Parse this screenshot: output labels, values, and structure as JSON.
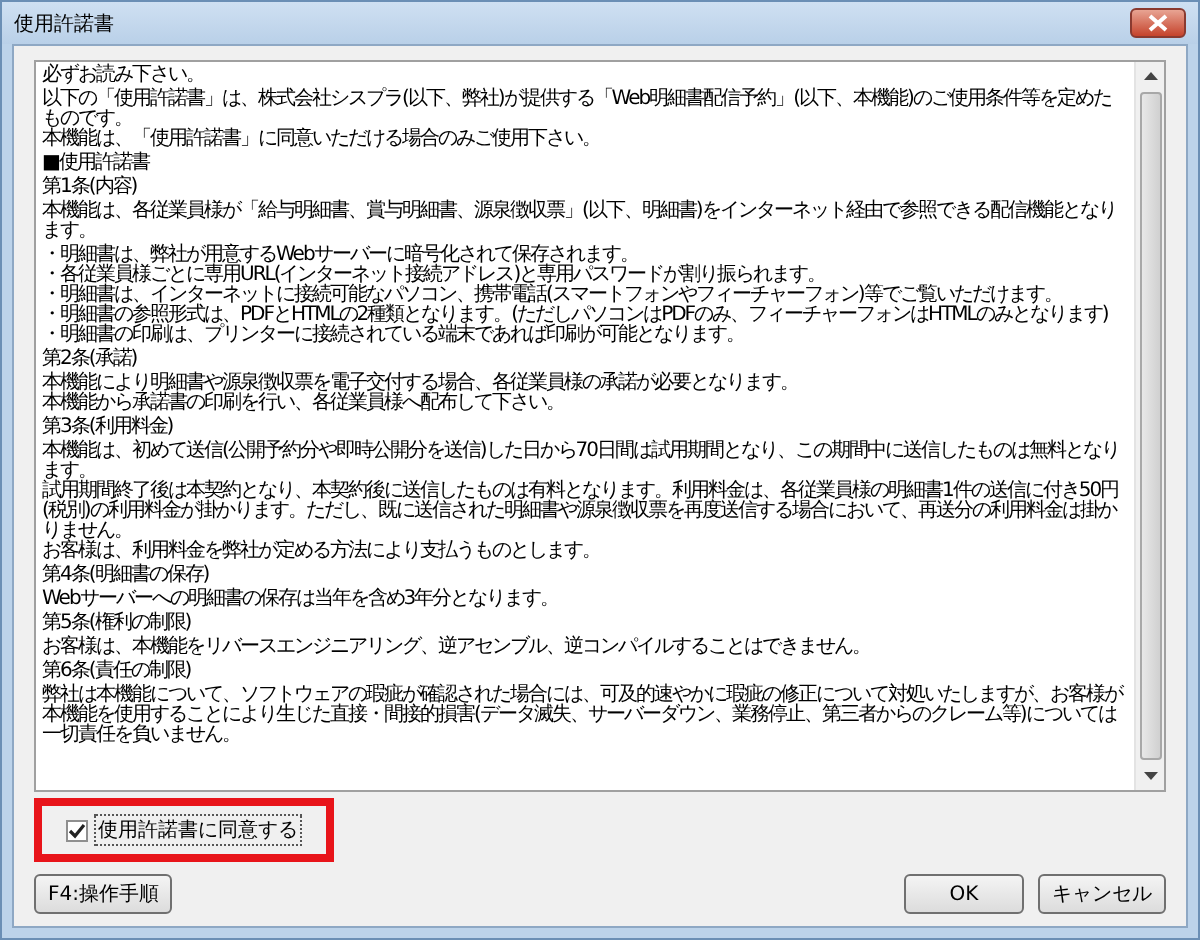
{
  "window": {
    "title": "使用許諾書"
  },
  "license_text": [
    {
      "lines": [
        "必ずお読み下さい。"
      ]
    },
    {
      "lines": [
        "以下の「使用許諾書」は、株式会社シスプラ(以下、弊社)が提供する「Web明細書配信予約」(以下、本機能)のご使用条件等を定めたものです。",
        "本機能は、「使用許諾書」に同意いただける場合のみご使用下さい。"
      ]
    },
    {
      "lines": [
        "■使用許諾書"
      ]
    },
    {
      "lines": [
        "第1条(内容)"
      ]
    },
    {
      "lines": [
        "本機能は、各従業員様が「給与明細書、賞与明細書、源泉徴収票」(以下、明細書)をインターネット経由で参照できる配信機能となります。"
      ]
    },
    {
      "lines": [
        "・明細書は、弊社が用意するWebサーバーに暗号化されて保存されます。",
        "・各従業員様ごとに専用URL(インターネット接続アドレス)と専用パスワードが割り振られます。",
        "・明細書は、インターネットに接続可能なパソコン、携帯電話(スマートフォンやフィーチャーフォン)等でご覧いただけます。",
        "・明細書の参照形式は、PDFとHTMLの2種類となります。(ただしパソコンはPDFのみ、フィーチャーフォンはHTMLのみとなります)",
        "・明細書の印刷は、プリンターに接続されている端末であれば印刷が可能となります。"
      ]
    },
    {
      "lines": [
        "第2条(承諾)"
      ]
    },
    {
      "lines": [
        "本機能により明細書や源泉徴収票を電子交付する場合、各従業員様の承諾が必要となります。",
        "本機能から承諾書の印刷を行い、各従業員様へ配布して下さい。"
      ]
    },
    {
      "lines": [
        "第3条(利用料金)"
      ]
    },
    {
      "lines": [
        "本機能は、初めて送信(公開予約分や即時公開分を送信)した日から70日間は試用期間となり、この期間中に送信したものは無料となります。",
        "試用期間終了後は本契約となり、本契約後に送信したものは有料となります。利用料金は、各従業員様の明細書1件の送信に付き50円(税別)の利用料金が掛かります。ただし、既に送信された明細書や源泉徴収票を再度送信する場合において、再送分の利用料金は掛かりません。",
        "お客様は、利用料金を弊社が定める方法により支払うものとします。"
      ]
    },
    {
      "lines": [
        "第4条(明細書の保存)"
      ]
    },
    {
      "lines": [
        "Webサーバーへの明細書の保存は当年を含め3年分となります。"
      ]
    },
    {
      "lines": [
        "第5条(権利の制限)"
      ]
    },
    {
      "lines": [
        "お客様は、本機能をリバースエンジニアリング、逆アセンブル、逆コンパイルすることはできません。"
      ]
    },
    {
      "lines": [
        "第6条(責任の制限)"
      ]
    },
    {
      "lines": [
        "弊社は本機能について、ソフトウェアの瑕疵が確認された場合には、可及的速やかに瑕疵の修正について対処いたしますが、お客様が本機能を使用することにより生じた直接・間接的損害(データ滅失、サーバーダウン、業務停止、第三者からのクレーム等)については一切責任を負いません。"
      ]
    }
  ],
  "agree_checkbox": {
    "label": "使用許諾書に同意する",
    "checked": true,
    "highlighted": true
  },
  "buttons": {
    "help": "F4:操作手順",
    "ok": "OK",
    "cancel": "キャンセル"
  }
}
